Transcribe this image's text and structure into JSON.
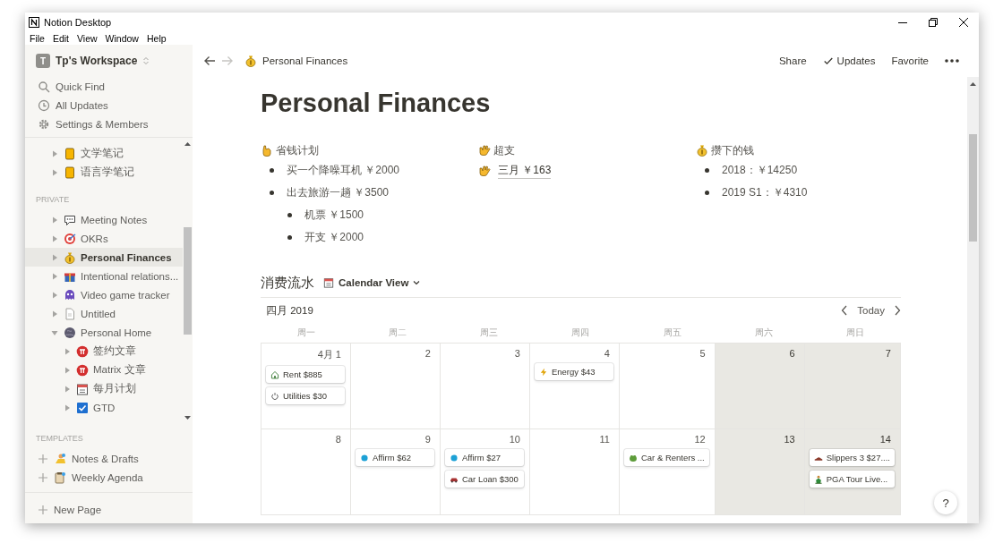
{
  "window": {
    "title": "Notion Desktop"
  },
  "menu": [
    "File",
    "Edit",
    "View",
    "Window",
    "Help"
  ],
  "sidebar": {
    "workspace": {
      "initial": "T",
      "name": "Tp's Workspace"
    },
    "actions": [
      {
        "kind": "search",
        "label": "Quick Find"
      },
      {
        "kind": "clock",
        "label": "All Updates"
      },
      {
        "kind": "gear",
        "label": "Settings & Members"
      }
    ],
    "sections": [
      {
        "items": [
          {
            "label": "文学笔记",
            "kind": "notebook",
            "expanded": false,
            "selected": false
          },
          {
            "label": "语言学笔记",
            "kind": "notebook",
            "expanded": false,
            "selected": false
          }
        ]
      },
      {
        "heading": "PRIVATE",
        "items": [
          {
            "label": "Meeting Notes",
            "kind": "chat",
            "expanded": false,
            "selected": false
          },
          {
            "label": "OKRs",
            "kind": "target",
            "expanded": false,
            "selected": false
          },
          {
            "label": "Personal Finances",
            "kind": "moneybag",
            "expanded": false,
            "selected": true
          },
          {
            "label": "Intentional relations...",
            "kind": "gift",
            "expanded": false,
            "selected": false
          },
          {
            "label": "Video game tracker",
            "kind": "alien",
            "expanded": false,
            "selected": false
          },
          {
            "label": "Untitled",
            "kind": "page",
            "expanded": false,
            "selected": false
          },
          {
            "label": "Personal Home",
            "kind": "globe",
            "expanded": true,
            "selected": false,
            "children": [
              {
                "label": "签约文章",
                "kind": "pi",
                "expanded": false,
                "selected": false
              },
              {
                "label": "Matrix 文章",
                "kind": "pi",
                "expanded": false,
                "selected": false
              },
              {
                "label": "每月计划",
                "kind": "calendar",
                "expanded": false,
                "selected": false
              },
              {
                "label": "GTD",
                "kind": "checkbox",
                "expanded": false,
                "selected": false
              }
            ]
          }
        ]
      }
    ],
    "templates": {
      "heading": "TEMPLATES",
      "items": [
        {
          "label": "Notes & Drafts",
          "kind": "person"
        },
        {
          "label": "Weekly Agenda",
          "kind": "clipboard"
        }
      ]
    },
    "new_page": "New Page"
  },
  "topbar": {
    "breadcrumb": {
      "kind": "moneybag",
      "label": "Personal Finances"
    },
    "actions": [
      {
        "label": "Share"
      },
      {
        "label": "Updates",
        "kind": "check"
      },
      {
        "label": "Favorite"
      }
    ]
  },
  "page": {
    "title": "Personal Finances",
    "columns": [
      {
        "kind": "hand",
        "title": "省钱计划",
        "items": [
          {
            "text": "买一个降噪耳机 ￥2000"
          },
          {
            "text": "出去旅游一趟 ￥3500",
            "children": [
              {
                "text": "机票 ￥1500"
              },
              {
                "text": "开支 ￥2000"
              }
            ]
          }
        ]
      },
      {
        "kind": "wave",
        "title": "超支",
        "links": [
          {
            "kind": "wave",
            "text": "三月 ￥163"
          }
        ]
      },
      {
        "kind": "moneybag",
        "title": "攒下的钱",
        "items": [
          {
            "text": "2018：￥14250"
          },
          {
            "text": "2019 S1：￥4310"
          }
        ]
      }
    ],
    "calendar": {
      "title": "消费流水",
      "view": "Calendar View",
      "month": "四月 2019",
      "today": "Today",
      "weekdays": [
        "周一",
        "周二",
        "周三",
        "周四",
        "周五",
        "周六",
        "周日"
      ],
      "weeks": [
        [
          {
            "day": "4月 1",
            "weekend": false,
            "events": [
              {
                "kind": "house",
                "label": "Rent $885"
              },
              {
                "kind": "recycle",
                "label": "Utilities $30"
              }
            ]
          },
          {
            "day": "2",
            "weekend": false
          },
          {
            "day": "3",
            "weekend": false
          },
          {
            "day": "4",
            "weekend": false,
            "events": [
              {
                "kind": "bolt",
                "label": "Energy $43"
              }
            ]
          },
          {
            "day": "5",
            "weekend": false
          },
          {
            "day": "6",
            "weekend": true
          },
          {
            "day": "7",
            "weekend": true
          }
        ],
        [
          {
            "day": "8",
            "weekend": false
          },
          {
            "day": "9",
            "weekend": false,
            "events": [
              {
                "kind": "dot",
                "label": "Affirm $62"
              }
            ]
          },
          {
            "day": "10",
            "weekend": false,
            "events": [
              {
                "kind": "dot",
                "label": "Affirm $27"
              },
              {
                "kind": "car",
                "label": "Car Loan $300"
              }
            ]
          },
          {
            "day": "11",
            "weekend": false
          },
          {
            "day": "12",
            "weekend": false,
            "events": [
              {
                "kind": "frog",
                "label": "Car & Renters ..."
              }
            ]
          },
          {
            "day": "13",
            "weekend": true
          },
          {
            "day": "14",
            "weekend": true,
            "events": [
              {
                "kind": "shoe",
                "label": "Slippers 3 $27...."
              },
              {
                "kind": "golfer",
                "label": "PGA Tour Live..."
              }
            ]
          }
        ]
      ]
    }
  },
  "help": "?"
}
